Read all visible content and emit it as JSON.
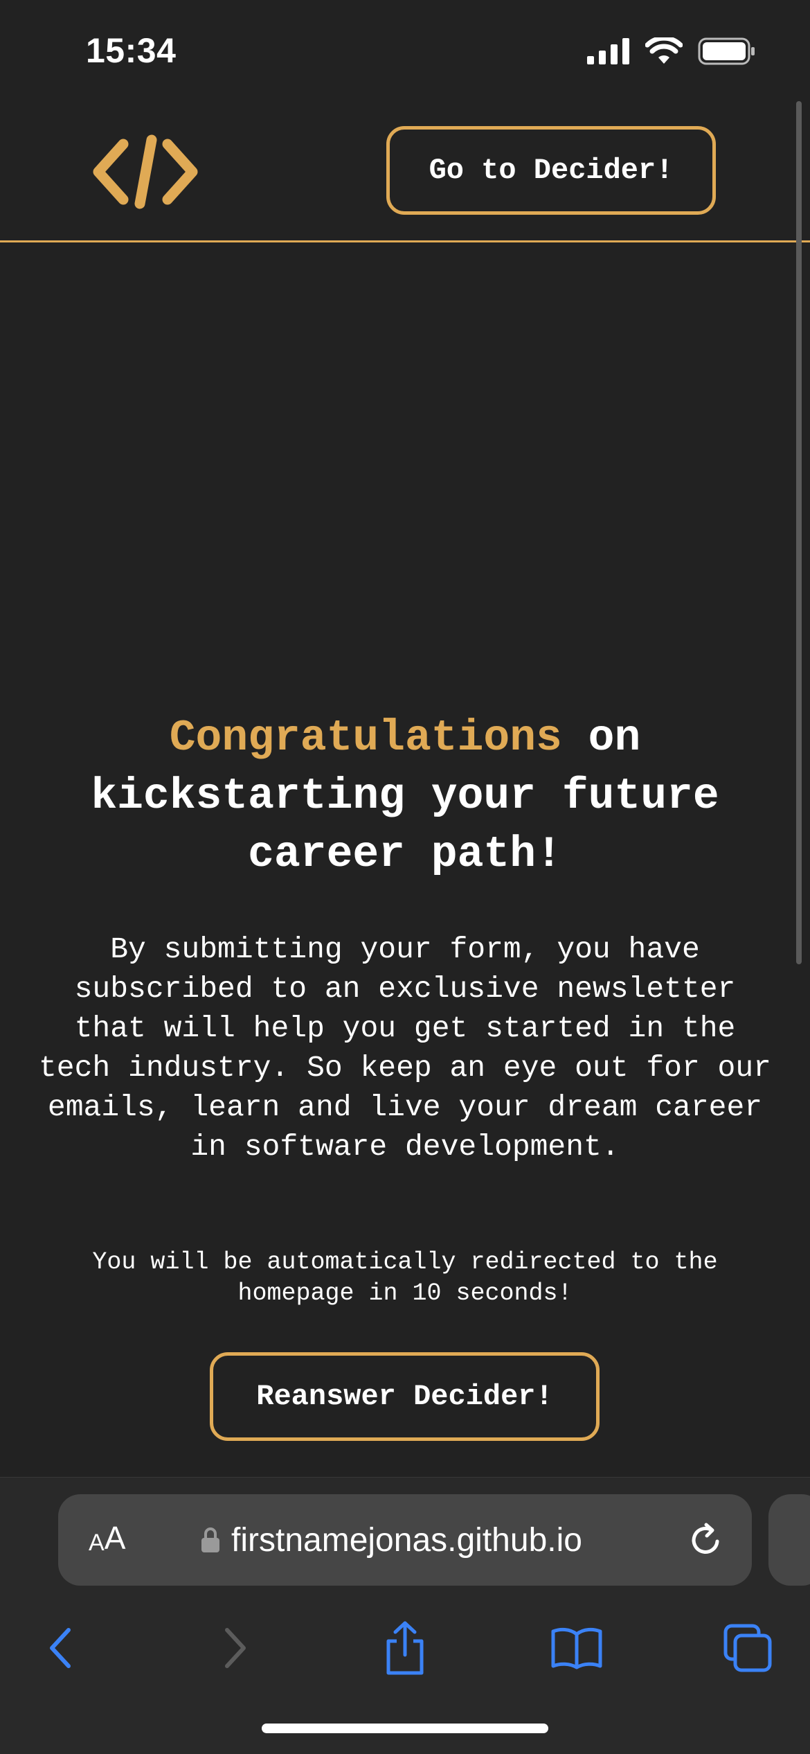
{
  "status_bar": {
    "time": "15:34",
    "icons": [
      "cellular-signal-icon",
      "wifi-icon",
      "battery-icon"
    ]
  },
  "header": {
    "logo_icon": "code-brackets-icon",
    "cta_label": "Go to Decider!"
  },
  "main": {
    "heading_accent": "Congratulations",
    "heading_rest": " on kickstarting your future career path!",
    "body": "By submitting your form, you have subscribed to an exclusive newsletter that will help you get started in the tech industry. So keep an eye out for our emails, learn and live your dream career in software development.",
    "redirect_notice": "You will be automatically redirected to the homepage in 10 seconds!",
    "reanswer_label": "Reanswer Decider!"
  },
  "browser": {
    "aa_small": "A",
    "aa_large": "A",
    "url": "firstnamejonas.github.io",
    "toolbar_icons": [
      "back-icon",
      "forward-icon",
      "share-icon",
      "bookmarks-icon",
      "tabs-icon"
    ]
  },
  "colors": {
    "background": "#222222",
    "accent": "#e0aa55",
    "text": "#ffffff",
    "browser_blue": "#3b82f6"
  }
}
